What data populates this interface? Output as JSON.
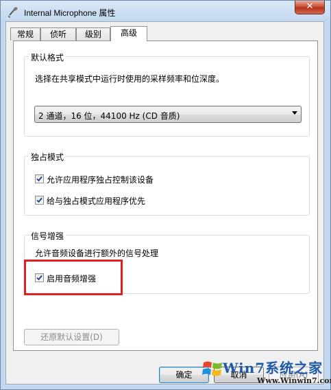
{
  "window": {
    "title": "Internal Microphone 属性",
    "close_label": "✕"
  },
  "tabs": [
    {
      "label": "常规"
    },
    {
      "label": "侦听"
    },
    {
      "label": "级别"
    },
    {
      "label": "高级"
    }
  ],
  "default_format": {
    "title": "默认格式",
    "description": "选择在共享模式中运行时使用的采样频率和位深度。",
    "selected": "2 通道，16 位，44100 Hz (CD 音质)"
  },
  "exclusive_mode": {
    "title": "独占模式",
    "options": [
      {
        "label": "允许应用程序独占控制该设备",
        "checked": true
      },
      {
        "label": "给与独占模式应用程序优先",
        "checked": true
      }
    ]
  },
  "signal_enhancement": {
    "title": "信号增强",
    "description": "允许音频设备进行额外的信号处理",
    "option": {
      "label": "启用音频增强",
      "checked": true
    }
  },
  "buttons": {
    "restore_defaults": "还原默认设置(D)",
    "ok": "确定",
    "cancel": "取消",
    "apply": "应用(A)"
  },
  "watermark": {
    "line1": "Win7系统之家",
    "line2": "Www.Winwin7.com"
  },
  "colors": {
    "highlight_border": "#e02020",
    "watermark_blue": "#1e5aa8"
  }
}
